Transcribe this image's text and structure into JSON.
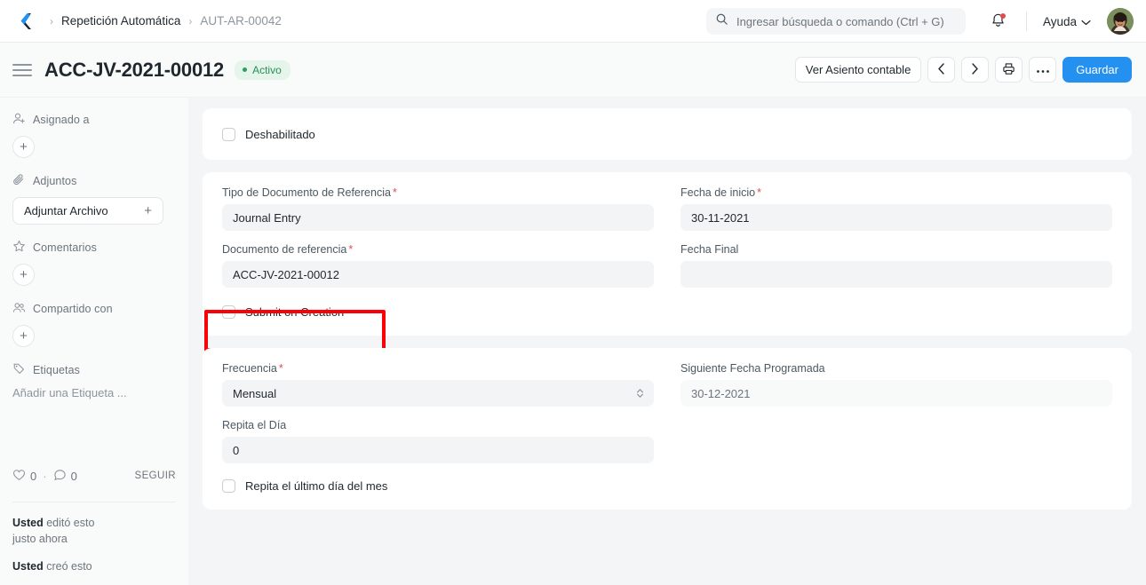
{
  "navbar": {
    "logo_icon": "chevron-left-logo-icon",
    "breadcrumb": {
      "separator": "›",
      "parent": "Repetición Automática",
      "current": "AUT-AR-00042"
    },
    "search": {
      "icon": "search-icon",
      "placeholder": "Ingresar búsqueda o comando (Ctrl + G)",
      "value": ""
    },
    "notifications": {
      "icon": "bell-icon",
      "has_unread": true
    },
    "help": {
      "label": "Ayuda",
      "icon": "chevron-down-icon"
    },
    "avatar": {
      "icon": "user-avatar"
    }
  },
  "pagehead": {
    "menu_icon": "hamburger-icon",
    "title": "ACC-JV-2021-00012",
    "status": {
      "label": "Activo",
      "color": "#278f53",
      "bg": "#e6f5ec"
    },
    "actions": {
      "view_ledger": "Ver Asiento contable",
      "prev_icon": "chevron-left-icon",
      "next_icon": "chevron-right-icon",
      "print_icon": "printer-icon",
      "more_icon": "ellipsis-icon",
      "save": "Guardar"
    }
  },
  "sidebar": {
    "sections": [
      {
        "icon": "assign-user-icon",
        "label": "Asignado a",
        "add_icon": "plus-icon"
      },
      {
        "icon": "paperclip-icon",
        "label": "Adjuntos",
        "button_label": "Adjuntar Archivo",
        "add_icon": "plus-icon"
      },
      {
        "icon": "star-icon",
        "label": "Comentarios",
        "add_icon": "plus-icon"
      },
      {
        "icon": "users-icon",
        "label": "Compartido con",
        "add_icon": "plus-icon"
      },
      {
        "icon": "tag-icon",
        "label": "Etiquetas",
        "placeholder": "Añadir una Etiqueta ..."
      }
    ],
    "stats": {
      "like_icon": "heart-icon",
      "like_count": "0",
      "separator": "·",
      "comment_icon": "comment-icon",
      "comment_count": "0",
      "follow_label": "SEGUIR"
    },
    "activity": [
      {
        "actor": "Usted",
        "action": "editó esto",
        "time": "justo ahora"
      },
      {
        "actor": "Usted",
        "action": "creó esto",
        "time": ""
      }
    ]
  },
  "form": {
    "section_disabled": {
      "checkbox": {
        "label": "Deshabilitado",
        "checked": false
      }
    },
    "section_reference": {
      "fields": [
        {
          "label": "Tipo de Documento de Referencia",
          "required": true,
          "value": "Journal Entry",
          "type": "link"
        },
        {
          "label": "Fecha de inicio",
          "required": true,
          "value": "30-11-2021",
          "type": "date"
        },
        {
          "label": "Documento de referencia",
          "required": true,
          "value": "ACC-JV-2021-00012",
          "type": "link"
        },
        {
          "label": "Fecha Final",
          "required": false,
          "value": "",
          "type": "date"
        }
      ],
      "checkbox": {
        "label": "Submit on Creation",
        "checked": false,
        "highlighted": true
      }
    },
    "section_frequency": {
      "fields": [
        {
          "label": "Frecuencia",
          "required": true,
          "value": "Mensual",
          "type": "select"
        },
        {
          "label": "Siguiente Fecha Programada",
          "required": false,
          "value": "30-12-2021",
          "type": "readonly"
        },
        {
          "label": "Repita el Día",
          "required": false,
          "value": "0",
          "type": "int"
        }
      ],
      "checkbox": {
        "label": "Repita el último día del mes",
        "checked": false
      }
    }
  },
  "annotation": {
    "color": "#fb0007",
    "target": "Submit on Creation"
  }
}
